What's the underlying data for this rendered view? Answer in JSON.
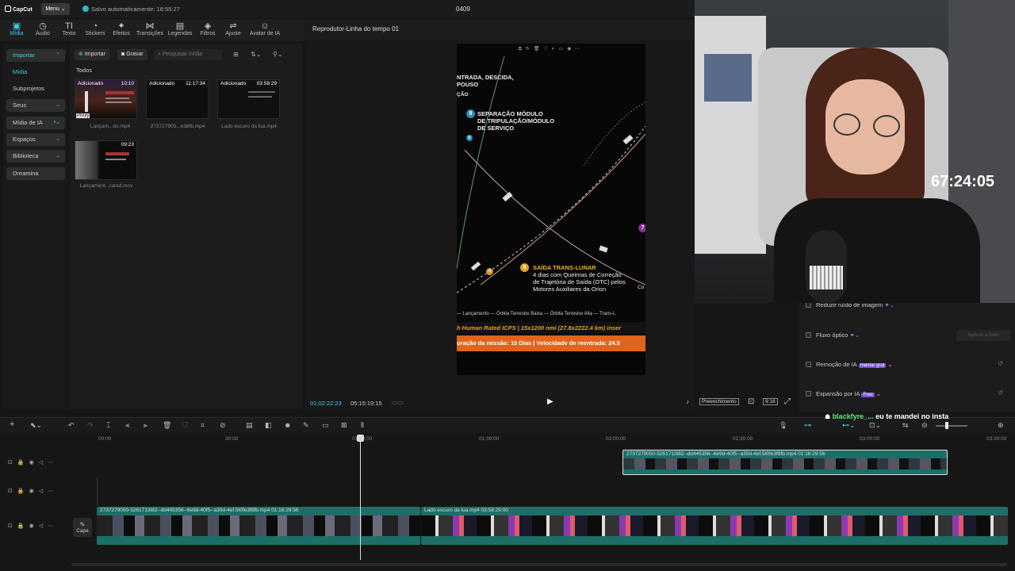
{
  "app": {
    "logo": "CapCut",
    "menu_label": "Menu",
    "save_status": "Salvo automaticamente: 16:55:27",
    "project_title": "0409"
  },
  "toolbar": {
    "items": [
      {
        "label": "Mídia",
        "icon": "▣"
      },
      {
        "label": "Áudio",
        "icon": "◷"
      },
      {
        "label": "Texto",
        "icon": "TI"
      },
      {
        "label": "Stickers",
        "icon": "◔"
      },
      {
        "label": "Efeitos",
        "icon": "✦"
      },
      {
        "label": "Transições",
        "icon": "⋈"
      },
      {
        "label": "Legendas",
        "icon": "▤"
      },
      {
        "label": "Filtros",
        "icon": "◈"
      },
      {
        "label": "Ajuste",
        "icon": "⇌"
      },
      {
        "label": "Avatar de IA",
        "icon": "☺"
      }
    ]
  },
  "sidebar": {
    "items": [
      {
        "label": "Importar"
      },
      {
        "label": "Mídia"
      },
      {
        "label": "Subprojetos"
      },
      {
        "label": "Seus"
      },
      {
        "label": "Mídia de IA"
      },
      {
        "label": "Espaços"
      },
      {
        "label": "Biblioteca"
      },
      {
        "label": "Dreamina"
      }
    ]
  },
  "media": {
    "import_label": "Importar",
    "record_label": "Gravar",
    "search_placeholder": "Pesquisar mídia",
    "section": "Todos",
    "items": [
      {
        "tag": "Adicionado",
        "duration": "10:10",
        "name": "Lançam...do.mp4",
        "proxy": "Proxy"
      },
      {
        "tag": "Adicionado",
        "duration": "11:17:34",
        "name": "273727905...e38fb.mp4"
      },
      {
        "tag": "Adicionado",
        "duration": "03:58:29",
        "name": "Lado escuro da lua.mp4"
      },
      {
        "tag": "",
        "duration": "09:23",
        "name": "Lançament...rared.mov"
      }
    ]
  },
  "player": {
    "title": "Reprodutor-Linha do tempo 01",
    "current_time": "01:02:22:23",
    "total_time": "05:15:19:15",
    "fill_label": "Preenchimento",
    "ratio_label": "9:16",
    "preview": {
      "l1": "NTRADA, DESCIDA,",
      "l2": "POUSO",
      "l3": "ÇÃO",
      "n8": "8",
      "step8_a": "SEPARAÇÃO MÓDULO",
      "step8_b": "DE TRIPULAÇÃO/MÓDULO",
      "step8_c": "DE SERVIÇO",
      "n5": "5",
      "step5_title": "SAÍDA TRANS-LUNAR",
      "step5_a": "4 dias com Queimas de Correção",
      "step5_b": "de Trajetória de Saída (OTC) pelos",
      "step5_c": "Motores Auxiliares da Orion",
      "n7": "7",
      "n4": "4",
      "n6": "6",
      "co": "Co",
      "legend": "— Lançamento   — Órbita Terrestre Baixa   — Órbita Terrestre Alta   — Trans-L",
      "banner1": "h Human Rated ICPS | 15x1200 nmi (27.8x2222.4 km) inser",
      "banner2": "uração da missão: 10 Dias | Velocidade de reentrada: 24.5"
    }
  },
  "right_panel": {
    "rows": [
      {
        "label": "Reduzir ruído de imagem"
      },
      {
        "label": "Fluxo óptico"
      },
      {
        "label": "Remoção de IA",
        "badge": "mentar grat"
      },
      {
        "label": "Expansão por IA",
        "badge": "Free"
      }
    ],
    "apply_label": "Aplicar a tudo"
  },
  "stream": {
    "timer": "67:24:05"
  },
  "chat": {
    "user": "blackfyre_...",
    "message": "eu te mandei no insta"
  },
  "ruler": {
    "ticks": [
      "00:00",
      "30:00",
      "01:00:00",
      "01:30:00",
      "02:00:00",
      "02:30:00",
      "03:00:00",
      "03:30:00"
    ]
  },
  "timeline": {
    "cover_label": "Capa",
    "clips": [
      {
        "label": "2737279050-5261713l82--dd445356--6e9d-40f5--a30d-4ef.5t0fe3f8fb.mp4   01:16:29:56"
      },
      {
        "label": "2737279050-5261713l82--dd445356--6e9d-40f5--a30d-4ef.5t0fe3f8fb.mp4   01:16:29:56"
      },
      {
        "label": "Lado escuro da lua.mp4   03:58:29:00"
      }
    ]
  },
  "colors": {
    "accent": "#3fd0dd",
    "clip_teal": "#1e6e68",
    "badge_purple": "#7b4fd6"
  }
}
